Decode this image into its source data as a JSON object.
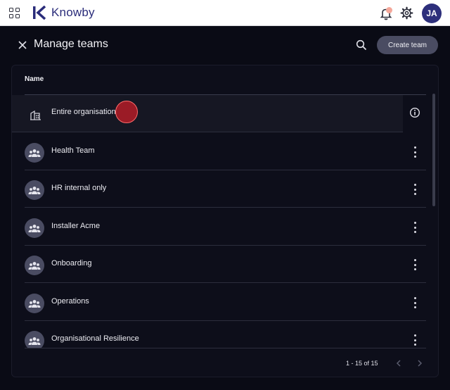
{
  "app": {
    "brand": "Knowby",
    "avatar_initials": "JA"
  },
  "header": {
    "title": "Manage teams",
    "create_label": "Create team"
  },
  "table": {
    "column_name": "Name",
    "rows": [
      {
        "label": "Entire organisation",
        "icon": "building-icon"
      },
      {
        "label": "Health Team",
        "icon": "team-icon"
      },
      {
        "label": "HR internal only",
        "icon": "team-icon"
      },
      {
        "label": "Installer Acme",
        "icon": "team-icon"
      },
      {
        "label": "Onboarding",
        "icon": "team-icon"
      },
      {
        "label": "Operations",
        "icon": "team-icon"
      },
      {
        "label": "Organisational Resilience",
        "icon": "team-icon"
      }
    ]
  },
  "pagination": {
    "range": "1 - 15 of 15"
  },
  "colors": {
    "accent": "#2d2f7b",
    "background": "#0a0b15",
    "button": "#4a4c62",
    "notification": "#f4a79a"
  }
}
